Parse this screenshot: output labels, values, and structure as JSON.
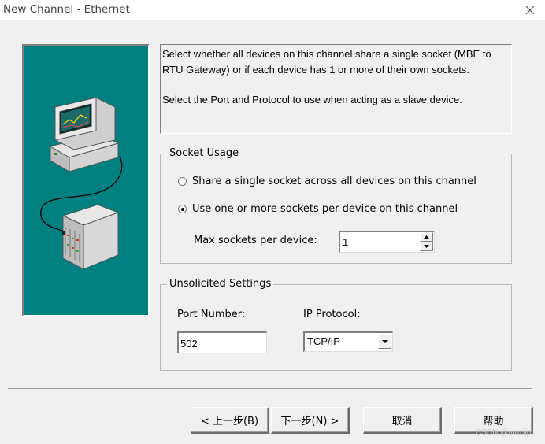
{
  "window": {
    "title": "New Channel - Ethernet",
    "close_icon": "close-icon"
  },
  "illustration": {
    "background_color": "#008080",
    "icons": [
      "computer-monitor-icon",
      "plc-rack-icon"
    ]
  },
  "description": {
    "paragraph1": "Select whether all devices on this channel share a single socket (MBE to RTU Gateway) or if each device has 1 or more of their own sockets.",
    "paragraph2": "Select the Port and Protocol to use when acting as a slave device."
  },
  "socket_usage": {
    "legend": "Socket Usage",
    "option_single": "Share a single socket across all devices on this channel",
    "option_multiple": "Use one or more sockets per device on this channel",
    "selected": "option_multiple",
    "max_sockets_label": "Max sockets per device:",
    "max_sockets_value": "1"
  },
  "unsolicited": {
    "legend": "Unsolicited Settings",
    "port_label": "Port Number:",
    "port_value": "502",
    "protocol_label": "IP Protocol:",
    "protocol_value": "TCP/IP"
  },
  "buttons": {
    "back": "< 上一步(B)",
    "next": "下一步(N) >",
    "cancel": "取消",
    "help": "帮助"
  },
  "watermark": "CSDN @muzijp"
}
